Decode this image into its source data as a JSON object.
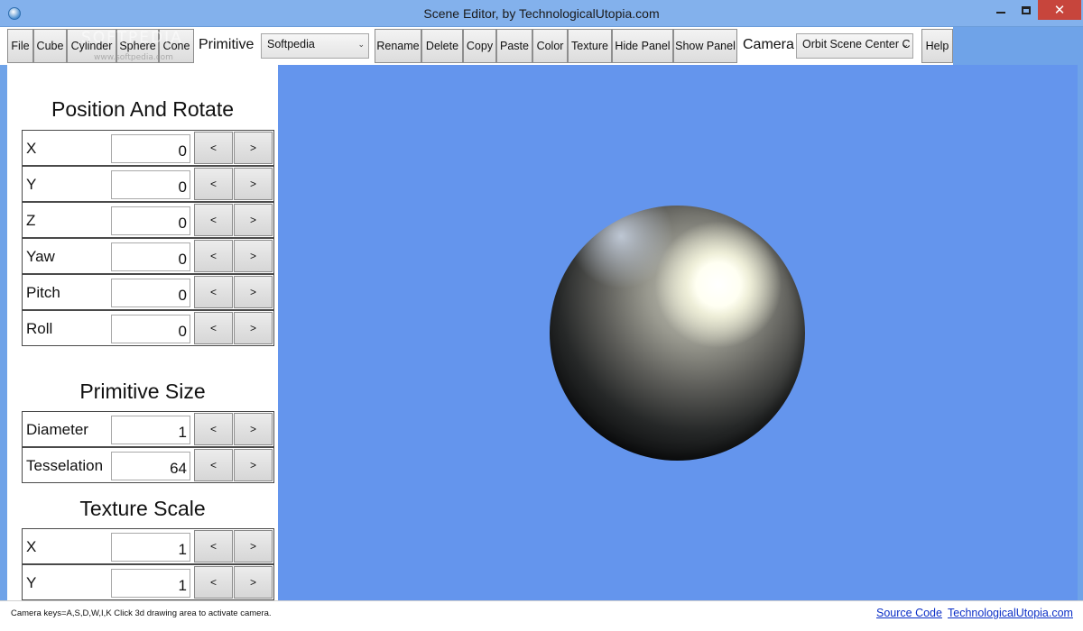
{
  "window": {
    "title": "Scene Editor, by TechnologicalUtopia.com"
  },
  "watermark": {
    "text": "SOFTPEDIA",
    "sub": "www.softpedia.com"
  },
  "toolbar": {
    "file": "File",
    "cube": "Cube",
    "cylinder": "Cylinder",
    "sphere": "Sphere",
    "cone": "Cone",
    "primitive_label": "Primitive",
    "primitive_select": "Softpedia",
    "rename": "Rename",
    "delete": "Delete",
    "copy": "Copy",
    "paste": "Paste",
    "color": "Color",
    "texture": "Texture",
    "hide_panel": "Hide Panel",
    "show_panel": "Show Panel",
    "camera_label": "Camera",
    "camera_select": "Orbit Scene Center C",
    "help": "Help"
  },
  "panel": {
    "position_title": "Position And Rotate",
    "position_rows": [
      {
        "label": "X",
        "value": "0"
      },
      {
        "label": "Y",
        "value": "0"
      },
      {
        "label": "Z",
        "value": "0"
      },
      {
        "label": "Yaw",
        "value": "0"
      },
      {
        "label": "Pitch",
        "value": "0"
      },
      {
        "label": "Roll",
        "value": "0"
      }
    ],
    "size_title": "Primitive Size",
    "size_rows": [
      {
        "label": "Diameter",
        "value": "1"
      },
      {
        "label": "Tesselation",
        "value": "64"
      }
    ],
    "texture_title": "Texture Scale",
    "texture_rows": [
      {
        "label": "X",
        "value": "1"
      },
      {
        "label": "Y",
        "value": "1"
      }
    ],
    "dec_label": "<",
    "inc_label": ">"
  },
  "status": {
    "hint": "Camera keys=A,S,D,W,I,K   Click 3d drawing area to activate camera.",
    "source_link": "Source Code",
    "site_link": "TechnologicalUtopia.com"
  },
  "colors": {
    "viewport_bg": "#6495ed",
    "titlebar_bg": "#83b1ec",
    "close_button": "#c7453c"
  }
}
